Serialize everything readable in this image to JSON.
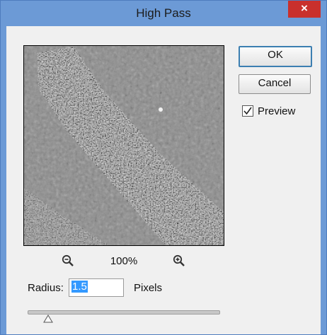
{
  "dialog": {
    "title": "High Pass",
    "close_glyph": "×"
  },
  "preview": {
    "image": "high-pass-filtered-texture",
    "zoom_level": "100%"
  },
  "buttons": {
    "ok_label": "OK",
    "cancel_label": "Cancel"
  },
  "preview_option": {
    "label": "Preview",
    "checked": true
  },
  "radius": {
    "label": "Radius:",
    "value": "1.5",
    "unit_label": "Pixels",
    "slider_fraction": 0.05
  },
  "icons": {
    "zoom_out": "zoom-out-icon",
    "zoom_in": "zoom-in-icon",
    "close": "close-icon",
    "checkmark": "check-icon",
    "slider_thumb": "triangle-thumb-icon"
  },
  "colors": {
    "titlebar": "#6c9ad6",
    "close_button": "#c9302c",
    "dialog_background": "#f0f0f0",
    "ok_border": "#3c7fb1",
    "selection": "#3399ff"
  }
}
